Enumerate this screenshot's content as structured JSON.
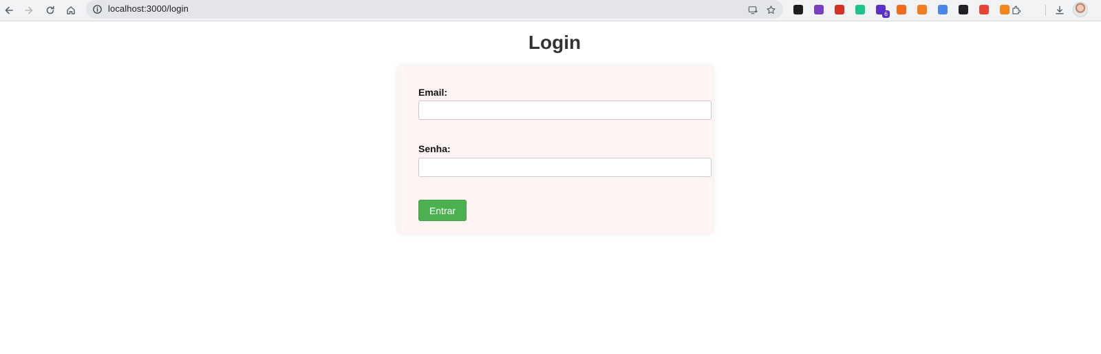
{
  "browser": {
    "url": "localhost:3000/login",
    "extensions": [
      {
        "name": "eyedropper-extension-icon",
        "color": "#1e1e1e"
      },
      {
        "name": "color-wheel-extension-icon",
        "color": "#7b3fbf"
      },
      {
        "name": "screenshot-extension-icon",
        "color": "#d93025"
      },
      {
        "name": "bird-extension-icon",
        "color": "#1ec28b"
      },
      {
        "name": "graduation-extension-icon",
        "color": "#5b2fc9",
        "badge": "6"
      },
      {
        "name": "bolt-extension-icon",
        "color": "#f26b1d"
      },
      {
        "name": "fox-extension-icon",
        "color": "#f47b20"
      },
      {
        "name": "clipboard-extension-icon",
        "color": "#4a86e8"
      },
      {
        "name": "fx-extension-icon",
        "color": "#202124"
      },
      {
        "name": "chrome-extension-icon",
        "color": "#ea4335"
      },
      {
        "name": "metamask-extension-icon",
        "color": "#f6851b"
      }
    ]
  },
  "page": {
    "title": "Login"
  },
  "form": {
    "email_label": "Email:",
    "email_value": "",
    "password_label": "Senha:",
    "password_value": "",
    "submit_label": "Entrar"
  },
  "colors": {
    "accent": "#4caf50",
    "card_background": "#fff4f3",
    "title_color": "#333333"
  }
}
